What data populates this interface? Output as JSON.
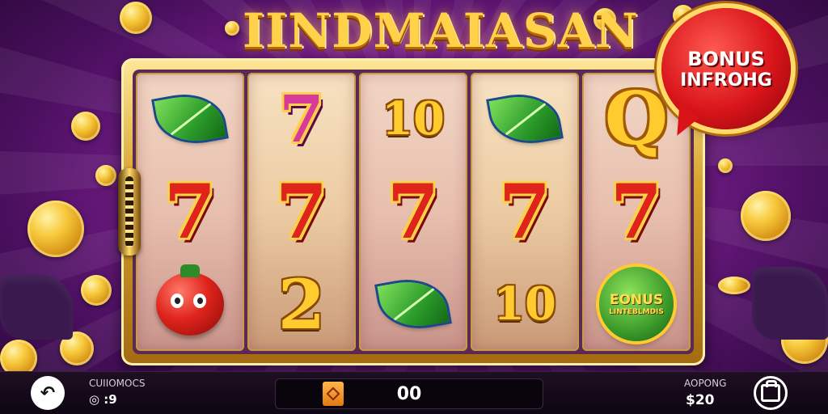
{
  "game": {
    "title": "IINDMAIASAN",
    "bonus_bubble": {
      "line1": "BONUS",
      "line2": "INFROHG"
    }
  },
  "reels": [
    {
      "symbols": [
        {
          "type": "leaf-icon"
        },
        {
          "type": "seven"
        },
        {
          "type": "tomato-icon"
        }
      ]
    },
    {
      "symbols": [
        {
          "type": "seven-pink"
        },
        {
          "type": "seven"
        },
        {
          "type": "text",
          "text": "2"
        }
      ]
    },
    {
      "symbols": [
        {
          "type": "text",
          "text": "10"
        },
        {
          "type": "seven"
        },
        {
          "type": "leaf-icon"
        }
      ]
    },
    {
      "symbols": [
        {
          "type": "leaf-icon"
        },
        {
          "type": "seven"
        },
        {
          "type": "text",
          "text": "10"
        }
      ]
    },
    {
      "symbols": [
        {
          "type": "text",
          "text": "Q"
        },
        {
          "type": "seven"
        },
        {
          "type": "bonus-badge",
          "line1": "EONUS",
          "line2": "LINTEBLMDIS"
        }
      ]
    }
  ],
  "reel_text": {
    "r1c0": "7",
    "r1c1": "7",
    "r1c2": "7",
    "r1c3": "7",
    "r1c4": "7",
    "r0c1": "7",
    "r2c1": "2",
    "r0c2": "10",
    "r2c3": "10",
    "r0c4": "Q",
    "badge_line1": "EONUS",
    "badge_line2": "LINTEBLMDIS"
  },
  "bottom_bar": {
    "left_label": "CUIIOMOCS",
    "left_value": "◎ :9",
    "bet_value": "00",
    "right_label": "AOPONG",
    "right_value": "$20"
  },
  "colors": {
    "background": "#7a1f8e",
    "gold": "#ffcb2e",
    "seven_red": "#e0241c",
    "bonus_red": "#d8141a",
    "bar": "#0e0612"
  }
}
